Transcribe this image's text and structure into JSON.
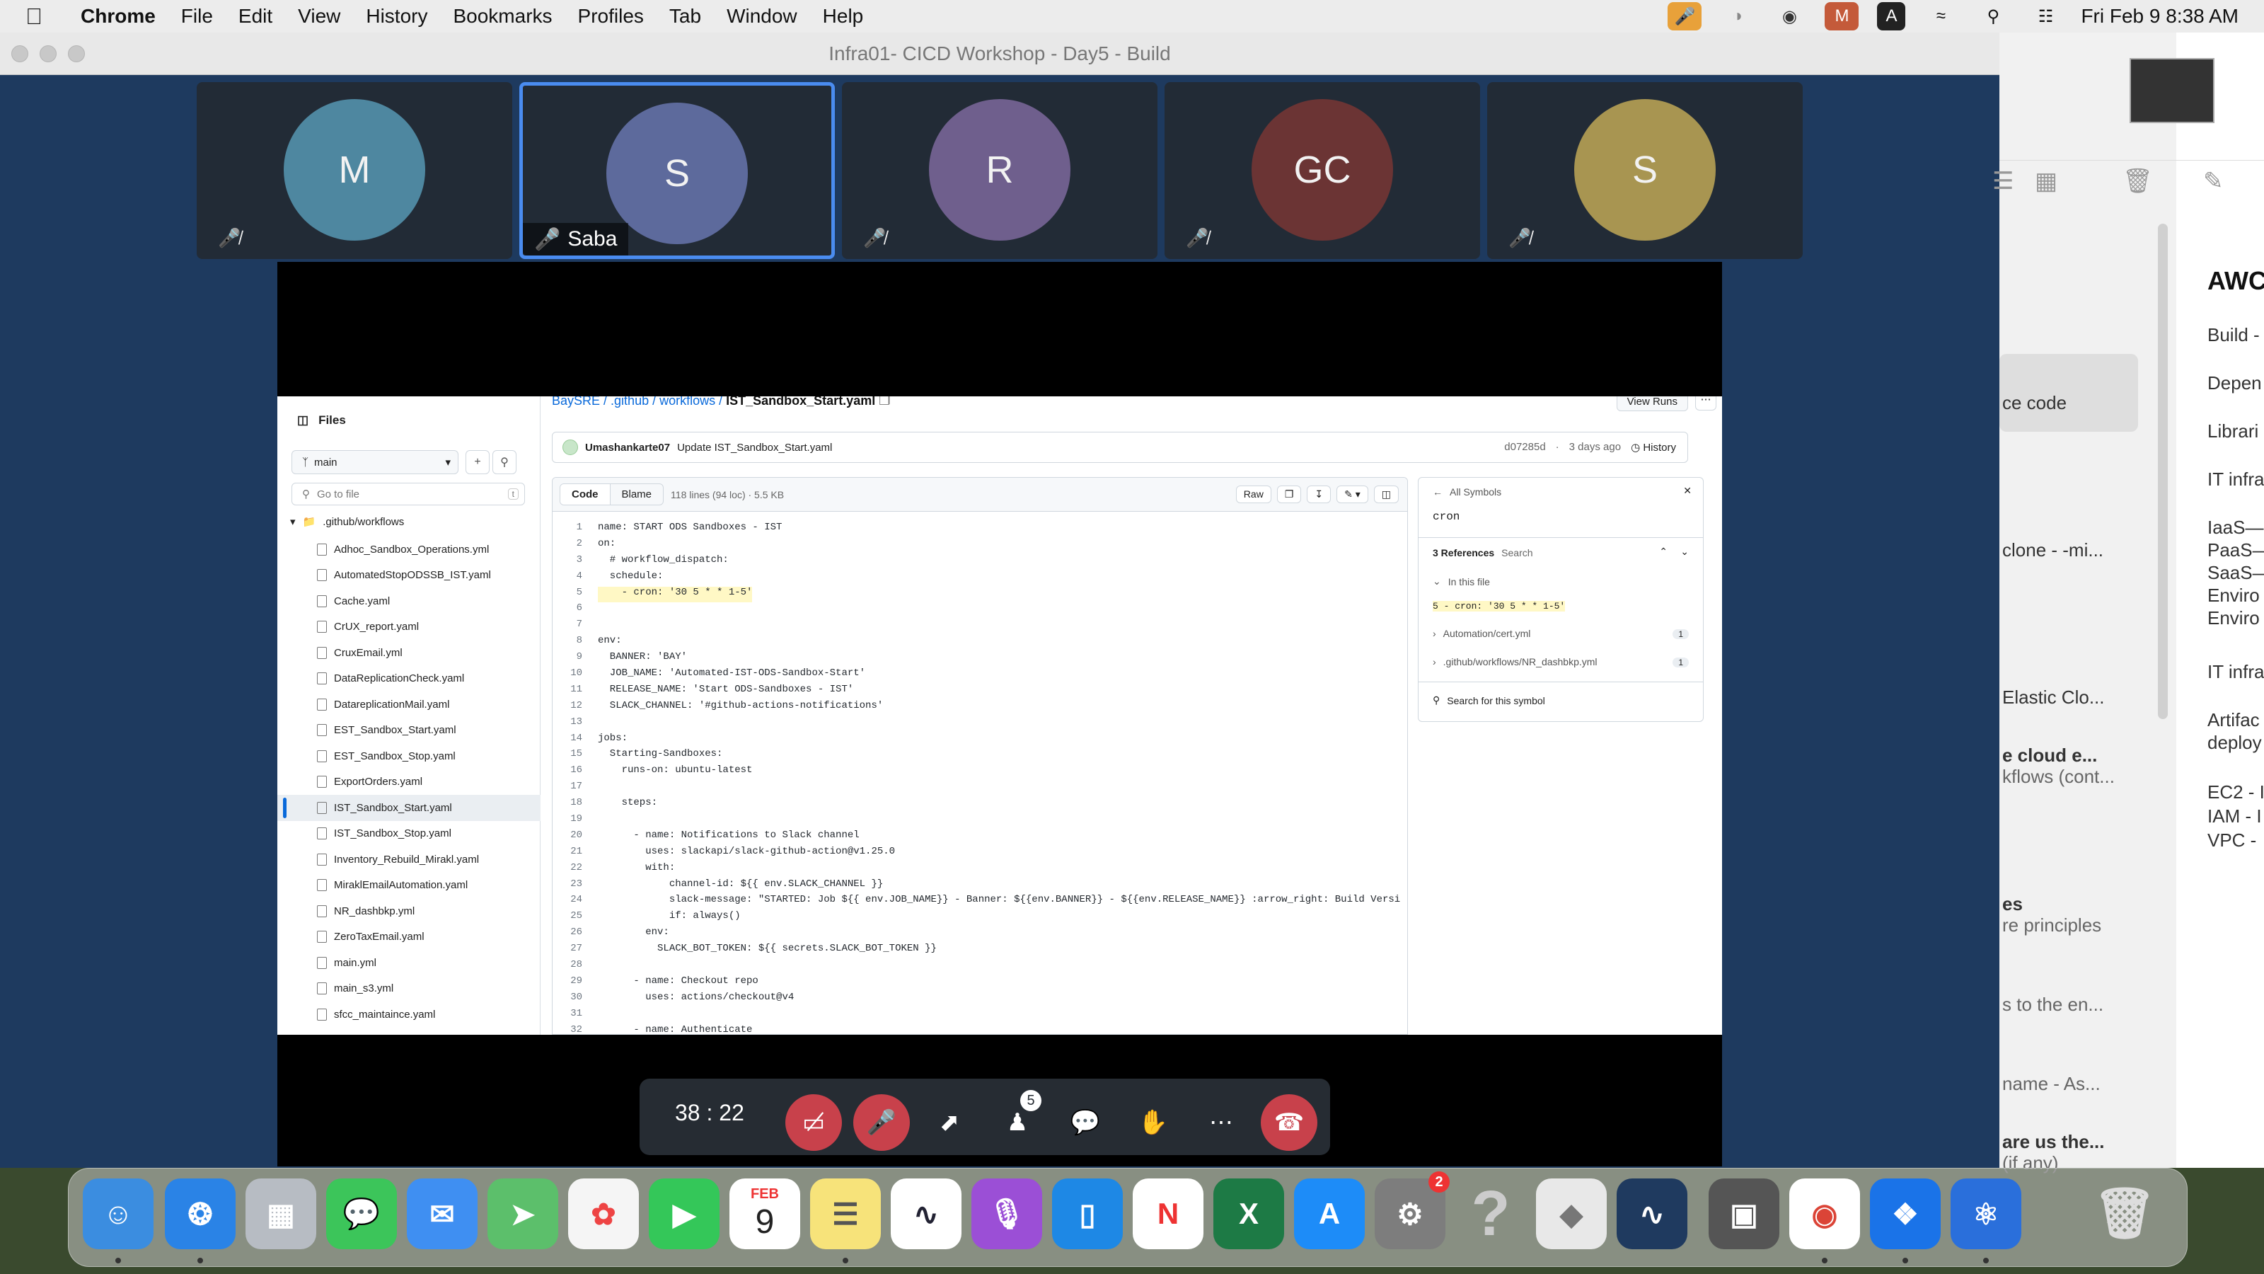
{
  "menubar": {
    "app": "Chrome",
    "items": [
      "File",
      "Edit",
      "View",
      "History",
      "Bookmarks",
      "Profiles",
      "Tab",
      "Window",
      "Help"
    ],
    "datetime": "Fri Feb 9  8:38 AM",
    "input_source": "A"
  },
  "window": {
    "title": "Infra01- CICD Workshop - Day5 - Build"
  },
  "participants": [
    {
      "initials": "M",
      "color": "#4e87a0",
      "muted": true,
      "name": ""
    },
    {
      "initials": "S",
      "color": "#5d6a9c",
      "muted": false,
      "name": "Saba",
      "active": true
    },
    {
      "initials": "R",
      "color": "#6f5f8d",
      "muted": true,
      "name": ""
    },
    {
      "initials": "GC",
      "color": "#6b3434",
      "muted": true,
      "name": ""
    },
    {
      "initials": "S",
      "color": "#a89551",
      "muted": true,
      "name": ""
    }
  ],
  "github": {
    "files_label": "Files",
    "branch": "main",
    "goto_placeholder": "Go to file",
    "goto_key": "t",
    "folder": ".github/workflows",
    "files": [
      "Adhoc_Sandbox_Operations.yml",
      "AutomatedStopODSSB_IST.yaml",
      "Cache.yaml",
      "CrUX_report.yaml",
      "CruxEmail.yml",
      "DataReplicationCheck.yaml",
      "DatareplicationMail.yaml",
      "EST_Sandbox_Start.yaml",
      "EST_Sandbox_Stop.yaml",
      "ExportOrders.yaml",
      "IST_Sandbox_Start.yaml",
      "IST_Sandbox_Stop.yaml",
      "Inventory_Rebuild_Mirakl.yaml",
      "MiraklEmailAutomation.yaml",
      "NR_dashbkp.yml",
      "ZeroTaxEmail.yaml",
      "main.yml",
      "main_s3.yml",
      "sfcc_maintaince.yaml"
    ],
    "selected_file": "IST_Sandbox_Start.yaml",
    "breadcrumb": {
      "repo": "BaySRE",
      "p1": ".github",
      "p2": "workflows",
      "file": "IST_Sandbox_Start.yaml"
    },
    "view_runs": "View Runs",
    "commit": {
      "author": "Umashankarte07",
      "message": "Update IST_Sandbox_Start.yaml",
      "sha": "d07285d",
      "age": "3 days ago",
      "history": "History"
    },
    "tabs": {
      "code": "Code",
      "blame": "Blame",
      "info": "118 lines (94 loc) · 5.5 KB",
      "raw": "Raw"
    },
    "code_lines": [
      "name: START ODS Sandboxes - IST",
      "on:",
      "  # workflow_dispatch:",
      "  schedule:",
      "    - cron: '30 5 * * 1-5'",
      "",
      "",
      "env:",
      "  BANNER: 'BAY'",
      "  JOB_NAME: 'Automated-IST-ODS-Sandbox-Start'",
      "  RELEASE_NAME: 'Start ODS-Sandboxes - IST'",
      "  SLACK_CHANNEL: '#github-actions-notifications'",
      "",
      "jobs:",
      "  Starting-Sandboxes:",
      "    runs-on: ubuntu-latest",
      "",
      "    steps:",
      "",
      "      - name: Notifications to Slack channel",
      "        uses: slackapi/slack-github-action@v1.25.0",
      "        with:",
      "            channel-id: ${{ env.SLACK_CHANNEL }}",
      "            slack-message: \"STARTED: Job ${{ env.JOB_NAME}} - Banner: ${{env.BANNER}} - ${{env.RELEASE_NAME}} :arrow_right: Build Versi",
      "            if: always()",
      "        env:",
      "          SLACK_BOT_TOKEN: ${{ secrets.SLACK_BOT_TOKEN }}",
      "",
      "      - name: Checkout repo",
      "        uses: actions/checkout@v4",
      "",
      "      - name: Authenticate"
    ],
    "symbols": {
      "back": "All Symbols",
      "query": "cron",
      "refs": "3 References",
      "search": "Search",
      "in_file": "In this file",
      "hit": "5  - cron: '30 5 * * 1-5'",
      "ref1": "Automation/cert.yml",
      "ref1_n": "1",
      "ref2": ".github/workflows/NR_dashbkp.yml",
      "ref2_n": "1",
      "search_symbol": "Search for this symbol"
    }
  },
  "call": {
    "timer": "38 : 22",
    "participants_count": "5"
  },
  "notes": {
    "title": "AWC",
    "lines": [
      "Build -",
      "Depen",
      "Librari",
      "IT infra",
      "IaaS—",
      "PaaS—",
      "SaaS—",
      "Enviro",
      "Enviro",
      "IT infra",
      "Artifac",
      "deploy",
      "EC2 - I",
      "IAM - I",
      "VPC - "
    ],
    "mid": [
      "ce code",
      "clone - -mi...",
      "Elastic Clo...",
      "e cloud e...",
      "kflows (cont...",
      "es",
      "re principles",
      "s to the en...",
      "name - As...",
      "are us the...",
      "(if any)"
    ]
  },
  "dock": {
    "calendar_month": "FEB",
    "calendar_day": "9",
    "settings_badge": "2"
  },
  "colors": {
    "accent": "#4a8cf0",
    "end_call": "#c8414b",
    "link": "#0969da"
  }
}
